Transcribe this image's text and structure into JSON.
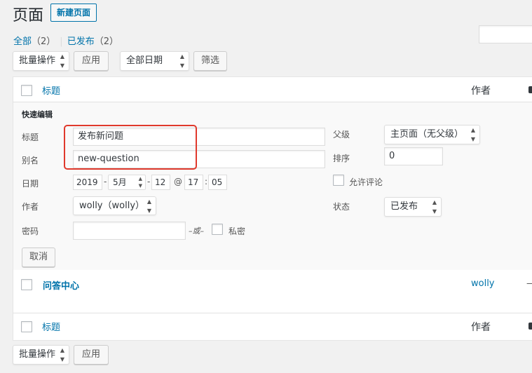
{
  "header": {
    "title": "页面",
    "add_new_label": "新建页面"
  },
  "views": {
    "all_label": "全部",
    "all_count": "（2）",
    "separator": "|",
    "published_label": "已发布",
    "published_count": "（2）"
  },
  "top_nav": {
    "bulk_actions": "批量操作",
    "apply_label": "应用",
    "date_filter": "全部日期",
    "filter_label": "筛选"
  },
  "table": {
    "column_title": "标题",
    "column_author": "作者"
  },
  "quick_edit": {
    "heading": "快速编辑",
    "title_label": "标题",
    "title_value": "发布新问题",
    "slug_label": "别名",
    "slug_value": "new-question",
    "date_label": "日期",
    "year": "2019",
    "month": "5月",
    "day": "12",
    "at": "@",
    "hour": "17",
    "minute": "05",
    "date_sep": "-",
    "time_sep": ":",
    "author_label": "作者",
    "author_value": "wolly（wolly）",
    "password_label": "密码",
    "password_value": "",
    "or_label": "–或–",
    "private_label": "私密",
    "parent_label": "父级",
    "parent_value": "主页面（无父级）",
    "order_label": "排序",
    "order_value": "0",
    "allow_comments_label": "允许评论",
    "status_label": "状态",
    "status_value": "已发布",
    "cancel_label": "取消"
  },
  "rows": [
    {
      "title": "问答中心",
      "author": "wolly",
      "comments": "—"
    }
  ],
  "bottom_nav": {
    "bulk_actions": "批量操作",
    "apply_label": "应用"
  },
  "colors": {
    "link": "#0073aa",
    "highlight": "#e0392c",
    "background": "#f1f1f1"
  }
}
